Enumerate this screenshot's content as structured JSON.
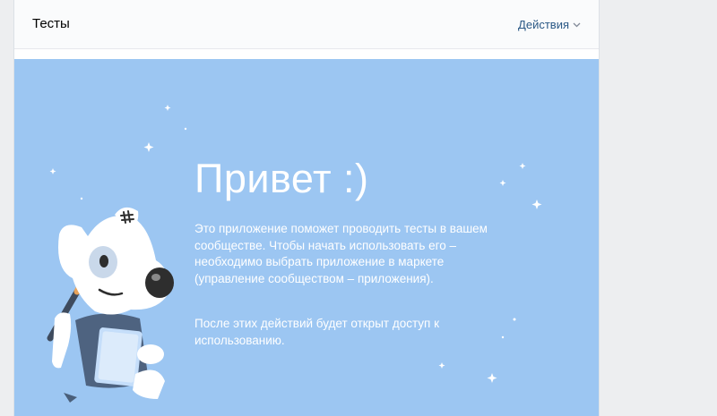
{
  "header": {
    "title": "Тесты",
    "actions_label": "Действия"
  },
  "banner": {
    "greeting": "Привет :)",
    "paragraph1": "Это приложение поможет проводить тесты в вашем сообществе. Чтобы начать использовать его – необходимо выбрать приложение в маркете (управление сообществом – приложения).",
    "paragraph2": "После этих действий будет открыт доступ к использованию."
  },
  "colors": {
    "page_bg": "#edeef0",
    "banner_bg": "#9cc6f2",
    "link": "#2a5885"
  },
  "icons": [
    "chevron-down-icon",
    "sparkle-icon",
    "dog-mascot"
  ]
}
